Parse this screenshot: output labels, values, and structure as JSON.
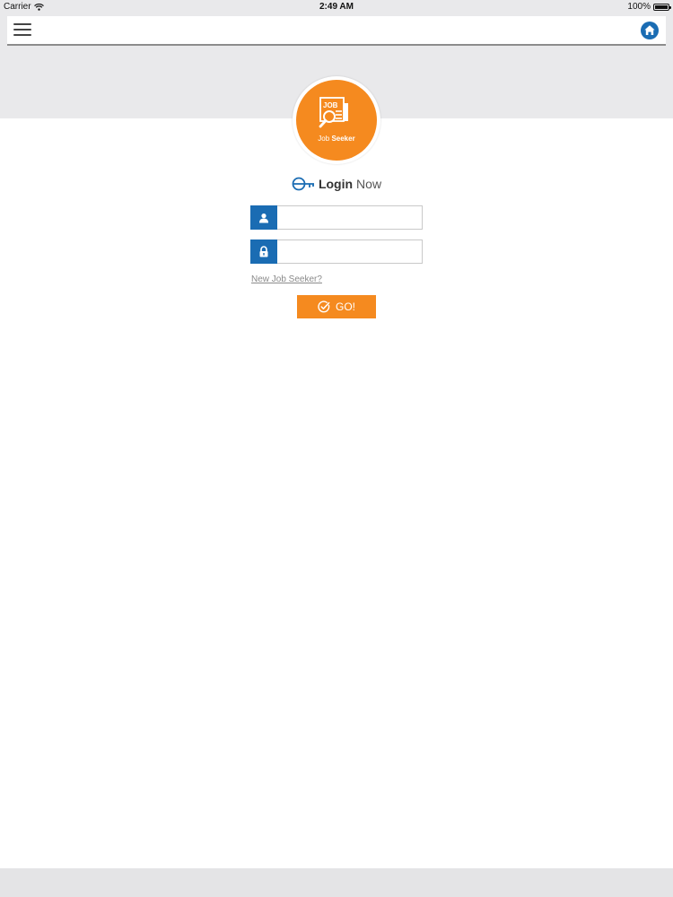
{
  "status_bar": {
    "carrier": "Carrier",
    "time": "2:49 AM",
    "battery": "100%",
    "battery_level": 1.0
  },
  "nav": {
    "menu_icon": "hamburger-menu-icon",
    "home_icon": "home-icon"
  },
  "logo": {
    "icon": "job-search-icon",
    "badge_text": "JOB",
    "caption_part1": "Job",
    "caption_part2": "Seeker"
  },
  "login": {
    "heading_bold": "Login",
    "heading_light": "Now",
    "key_icon": "key-icon",
    "username": {
      "icon": "user-icon",
      "value": "",
      "placeholder": ""
    },
    "password": {
      "icon": "lock-icon",
      "value": "",
      "placeholder": ""
    },
    "register_link": "New Job Seeker?",
    "submit_label": "GO!",
    "submit_icon": "check-circle-icon"
  },
  "colors": {
    "accent_orange": "#f58a1f",
    "addon_blue": "#1a6cb3",
    "band_gray": "#e9e9eb"
  }
}
